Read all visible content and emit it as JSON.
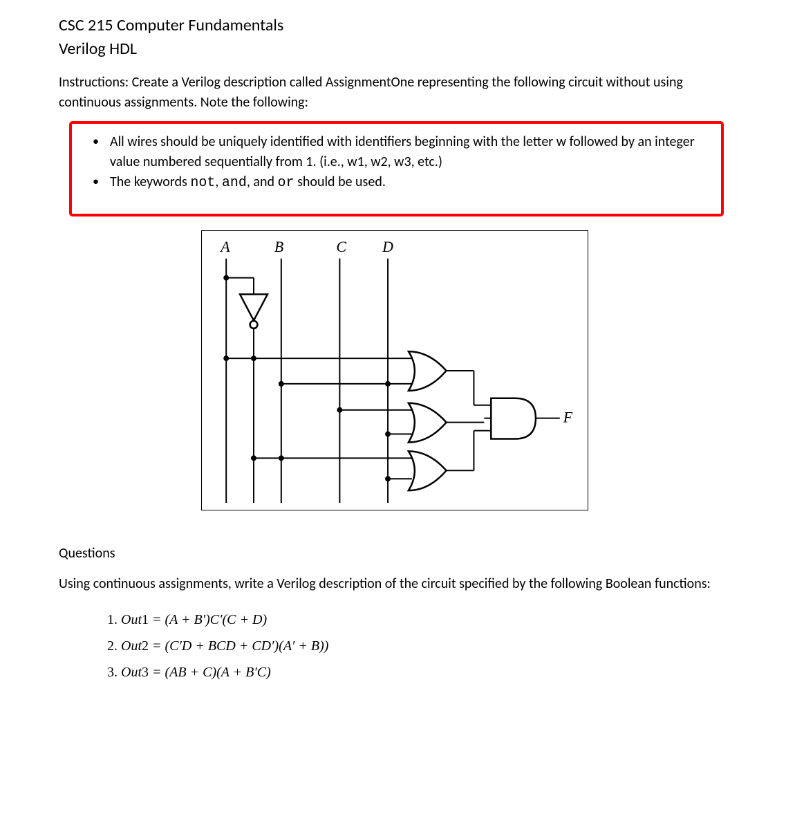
{
  "header": {
    "course": "CSC 215 Computer Fundamentals",
    "subject": "Verilog HDL"
  },
  "instructions_text": "Instructions: Create a Verilog description called AssignmentOne representing the following circuit without using continuous assignments. Note the following:",
  "bullets": {
    "b1_part1": "All wires should be uniquely identified with identifiers beginning with the letter w followed by an integer value numbered sequentially from 1.  (i.e., w1, w2, w3, etc.)",
    "b2_part1": "The keywords ",
    "b2_kw1": "not",
    "b2_sep1": ", ",
    "b2_kw2": "and",
    "b2_sep2": ", and ",
    "b2_kw3": "or",
    "b2_part2": " should be used."
  },
  "circuit": {
    "inputs": [
      "A",
      "B",
      "C",
      "D"
    ],
    "output": "F"
  },
  "questions": {
    "heading": "Questions",
    "intro": "Using continuous assignments, write a Verilog description of the circuit specified by the following Boolean functions:",
    "eq1_label": "1. Out1 = (A + B′)C′(C + D)",
    "eq2_label": "2. Out2 = (C′D + BCD + CD′)(A′ + B))",
    "eq3_label": "3. Out3 = (AB + C)(A + B′C)"
  }
}
